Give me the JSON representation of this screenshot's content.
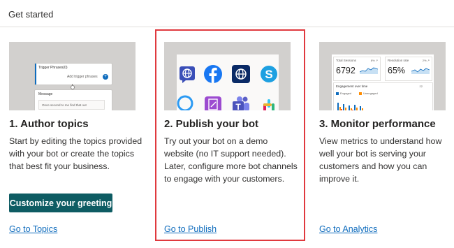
{
  "header": {
    "title": "Get started"
  },
  "cards": [
    {
      "heading": "1. Author topics",
      "description": "Start by editing the topics provided with your bot or create the topics that best fit your business.",
      "button_label": "Customize your greeting",
      "link_label": "Go to Topics",
      "thumbnail": {
        "trigger_title": "Trigger Phrases(0)",
        "add_trigger": "Add trigger phrases",
        "message_title": "Message",
        "message_text": "Once second to me find that out"
      }
    },
    {
      "heading": "2. Publish your bot",
      "description": "Try out your bot on a demo website (no IT support needed). Later, configure more bot channels to engage with your customers.",
      "link_label": "Go to Publish",
      "thumbnail": {
        "icons": [
          "globe-chat-icon",
          "facebook-icon",
          "web-globe-icon",
          "skype-icon",
          "cortana-ring-icon",
          "document-edit-icon",
          "teams-icon",
          "slack-icon"
        ]
      }
    },
    {
      "heading": "3. Monitor performance",
      "description": "View metrics to understand how well your bot is serving your customers and how you can improve it.",
      "link_label": "Go to Analytics",
      "thumbnail": {
        "kpi_sessions_label": "Total Sessions",
        "kpi_sessions_delta": "8% ↗",
        "kpi_sessions_value": "6792",
        "kpi_resolution_label": "Resolution rate",
        "kpi_resolution_delta": "2% ↗",
        "kpi_resolution_value": "65%",
        "engagement_title": "Engagement over time",
        "engagement_count": "22",
        "legend": [
          "Engaged",
          "Unengaged"
        ]
      }
    }
  ],
  "colors": {
    "accent": "#0e5c63",
    "link": "#0f6cbd",
    "highlight_border": "#e0393e"
  }
}
